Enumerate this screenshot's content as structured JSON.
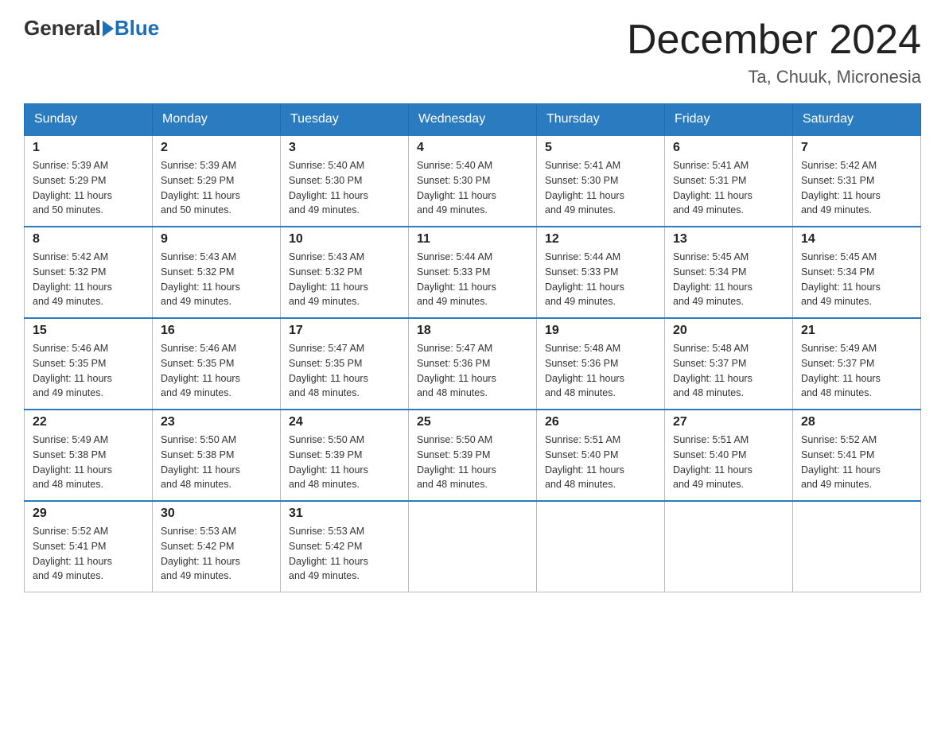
{
  "logo": {
    "general": "General",
    "blue": "Blue"
  },
  "title": "December 2024",
  "location": "Ta, Chuuk, Micronesia",
  "days_of_week": [
    "Sunday",
    "Monday",
    "Tuesday",
    "Wednesday",
    "Thursday",
    "Friday",
    "Saturday"
  ],
  "weeks": [
    [
      {
        "day": "1",
        "sunrise": "5:39 AM",
        "sunset": "5:29 PM",
        "daylight": "11 hours and 50 minutes."
      },
      {
        "day": "2",
        "sunrise": "5:39 AM",
        "sunset": "5:29 PM",
        "daylight": "11 hours and 50 minutes."
      },
      {
        "day": "3",
        "sunrise": "5:40 AM",
        "sunset": "5:30 PM",
        "daylight": "11 hours and 49 minutes."
      },
      {
        "day": "4",
        "sunrise": "5:40 AM",
        "sunset": "5:30 PM",
        "daylight": "11 hours and 49 minutes."
      },
      {
        "day": "5",
        "sunrise": "5:41 AM",
        "sunset": "5:30 PM",
        "daylight": "11 hours and 49 minutes."
      },
      {
        "day": "6",
        "sunrise": "5:41 AM",
        "sunset": "5:31 PM",
        "daylight": "11 hours and 49 minutes."
      },
      {
        "day": "7",
        "sunrise": "5:42 AM",
        "sunset": "5:31 PM",
        "daylight": "11 hours and 49 minutes."
      }
    ],
    [
      {
        "day": "8",
        "sunrise": "5:42 AM",
        "sunset": "5:32 PM",
        "daylight": "11 hours and 49 minutes."
      },
      {
        "day": "9",
        "sunrise": "5:43 AM",
        "sunset": "5:32 PM",
        "daylight": "11 hours and 49 minutes."
      },
      {
        "day": "10",
        "sunrise": "5:43 AM",
        "sunset": "5:32 PM",
        "daylight": "11 hours and 49 minutes."
      },
      {
        "day": "11",
        "sunrise": "5:44 AM",
        "sunset": "5:33 PM",
        "daylight": "11 hours and 49 minutes."
      },
      {
        "day": "12",
        "sunrise": "5:44 AM",
        "sunset": "5:33 PM",
        "daylight": "11 hours and 49 minutes."
      },
      {
        "day": "13",
        "sunrise": "5:45 AM",
        "sunset": "5:34 PM",
        "daylight": "11 hours and 49 minutes."
      },
      {
        "day": "14",
        "sunrise": "5:45 AM",
        "sunset": "5:34 PM",
        "daylight": "11 hours and 49 minutes."
      }
    ],
    [
      {
        "day": "15",
        "sunrise": "5:46 AM",
        "sunset": "5:35 PM",
        "daylight": "11 hours and 49 minutes."
      },
      {
        "day": "16",
        "sunrise": "5:46 AM",
        "sunset": "5:35 PM",
        "daylight": "11 hours and 49 minutes."
      },
      {
        "day": "17",
        "sunrise": "5:47 AM",
        "sunset": "5:35 PM",
        "daylight": "11 hours and 48 minutes."
      },
      {
        "day": "18",
        "sunrise": "5:47 AM",
        "sunset": "5:36 PM",
        "daylight": "11 hours and 48 minutes."
      },
      {
        "day": "19",
        "sunrise": "5:48 AM",
        "sunset": "5:36 PM",
        "daylight": "11 hours and 48 minutes."
      },
      {
        "day": "20",
        "sunrise": "5:48 AM",
        "sunset": "5:37 PM",
        "daylight": "11 hours and 48 minutes."
      },
      {
        "day": "21",
        "sunrise": "5:49 AM",
        "sunset": "5:37 PM",
        "daylight": "11 hours and 48 minutes."
      }
    ],
    [
      {
        "day": "22",
        "sunrise": "5:49 AM",
        "sunset": "5:38 PM",
        "daylight": "11 hours and 48 minutes."
      },
      {
        "day": "23",
        "sunrise": "5:50 AM",
        "sunset": "5:38 PM",
        "daylight": "11 hours and 48 minutes."
      },
      {
        "day": "24",
        "sunrise": "5:50 AM",
        "sunset": "5:39 PM",
        "daylight": "11 hours and 48 minutes."
      },
      {
        "day": "25",
        "sunrise": "5:50 AM",
        "sunset": "5:39 PM",
        "daylight": "11 hours and 48 minutes."
      },
      {
        "day": "26",
        "sunrise": "5:51 AM",
        "sunset": "5:40 PM",
        "daylight": "11 hours and 48 minutes."
      },
      {
        "day": "27",
        "sunrise": "5:51 AM",
        "sunset": "5:40 PM",
        "daylight": "11 hours and 49 minutes."
      },
      {
        "day": "28",
        "sunrise": "5:52 AM",
        "sunset": "5:41 PM",
        "daylight": "11 hours and 49 minutes."
      }
    ],
    [
      {
        "day": "29",
        "sunrise": "5:52 AM",
        "sunset": "5:41 PM",
        "daylight": "11 hours and 49 minutes."
      },
      {
        "day": "30",
        "sunrise": "5:53 AM",
        "sunset": "5:42 PM",
        "daylight": "11 hours and 49 minutes."
      },
      {
        "day": "31",
        "sunrise": "5:53 AM",
        "sunset": "5:42 PM",
        "daylight": "11 hours and 49 minutes."
      },
      null,
      null,
      null,
      null
    ]
  ],
  "labels": {
    "sunrise": "Sunrise:",
    "sunset": "Sunset:",
    "daylight": "Daylight:"
  }
}
